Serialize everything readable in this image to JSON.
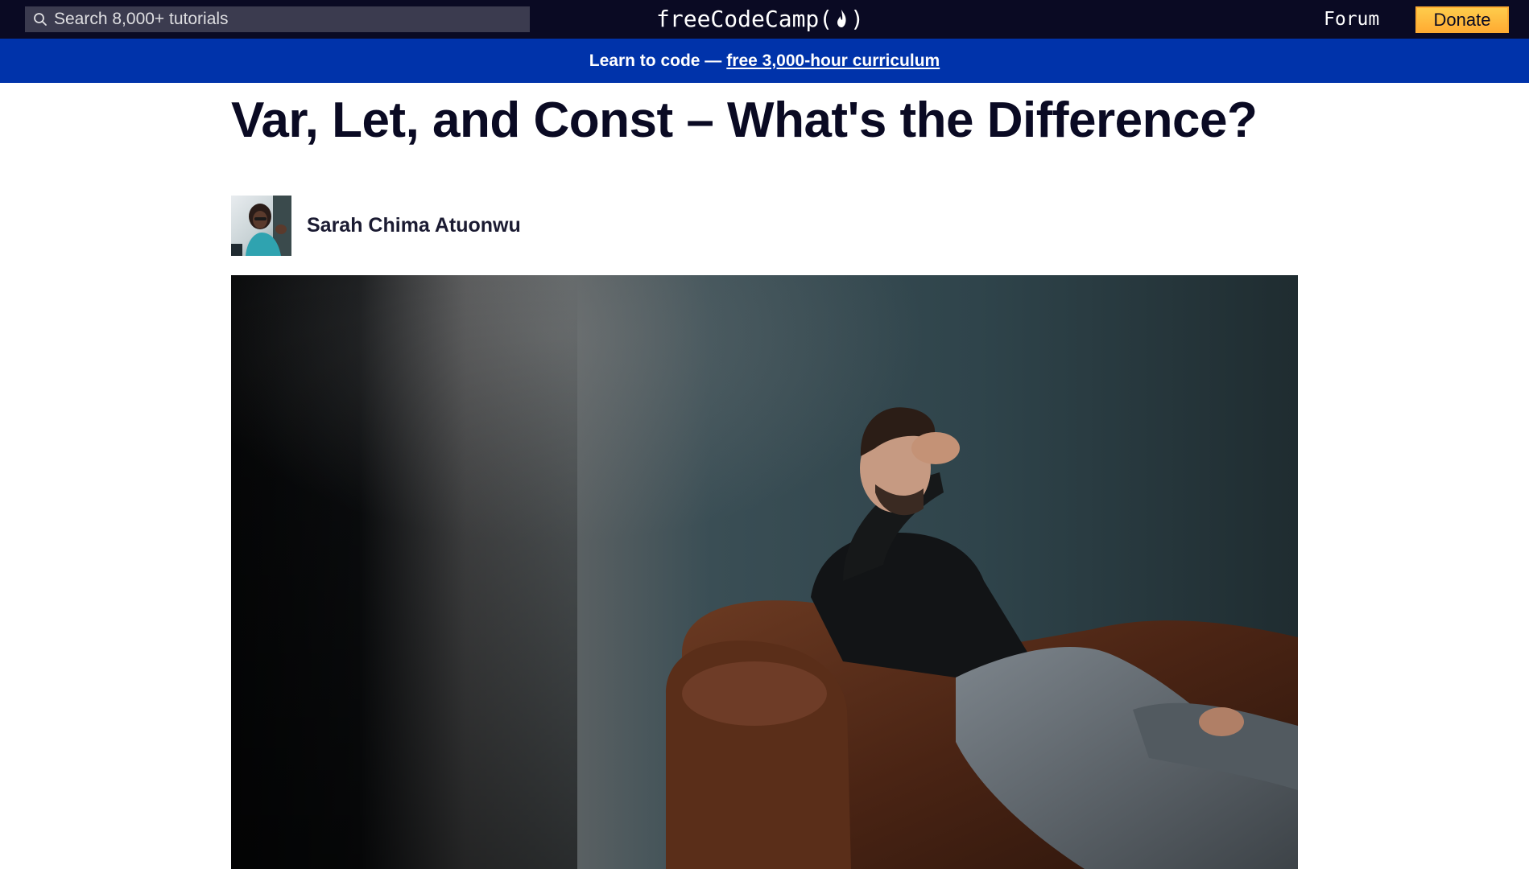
{
  "nav": {
    "search_placeholder": "Search 8,000+ tutorials",
    "logo_text_left": "freeCodeCamp(",
    "logo_text_right": ")",
    "forum_label": "Forum",
    "donate_label": "Donate",
    "colors": {
      "nav_bg": "#0a0a23",
      "search_bg": "#3b3b4f",
      "donate_bg": "#feac32"
    },
    "icons": {
      "search": "search-icon",
      "flame": "flame-icon"
    }
  },
  "banner": {
    "text": "Learn to code —",
    "link_text": "free 3,000-hour curriculum",
    "color": "#0033aa"
  },
  "article": {
    "title": "Var, Let, and Const – What's the Difference?",
    "author_name": "Sarah Chima Atuonwu",
    "author_avatar": "author-avatar-photo",
    "feature_image": "man-on-leather-sofa-with-hand-on-face-photo"
  }
}
